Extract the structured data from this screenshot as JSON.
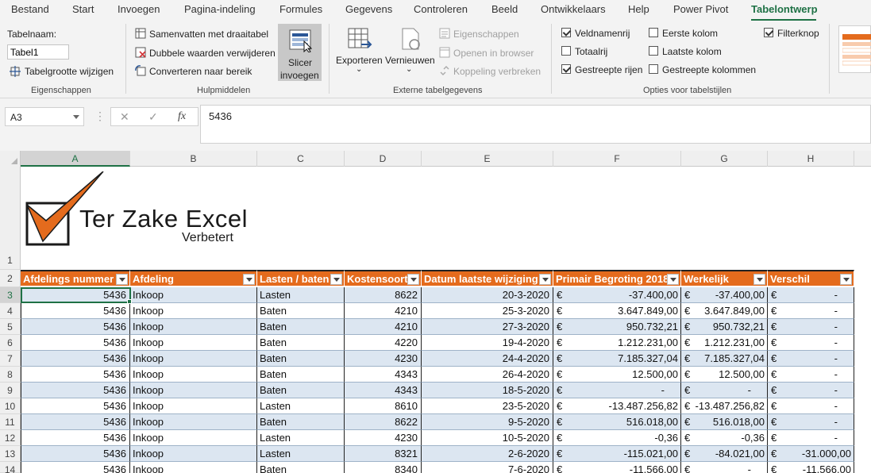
{
  "menu": {
    "items": [
      "Bestand",
      "Start",
      "Invoegen",
      "Pagina-indeling",
      "Formules",
      "Gegevens",
      "Controleren",
      "Beeld",
      "Ontwikkelaars",
      "Help",
      "Power Pivot",
      "Tabelontwerp"
    ],
    "active": "Tabelontwerp"
  },
  "ribbon": {
    "eigenschappen": {
      "tablename_label": "Tabelnaam:",
      "tablename_value": "Tabel1",
      "resize_label": "Tabelgrootte wijzigen",
      "group_label": "Eigenschappen"
    },
    "hulpmiddelen": {
      "pivot_label": "Samenvatten met draaitabel",
      "dedupe_label": "Dubbele waarden verwijderen",
      "convert_label": "Converteren naar bereik",
      "slicer_line1": "Slicer",
      "slicer_line2": "invoegen",
      "group_label": "Hulpmiddelen"
    },
    "extern": {
      "export_label": "Exporteren",
      "refresh_label": "Vernieuwen",
      "properties_label": "Eigenschappen",
      "browser_label": "Openen in browser",
      "unlink_label": "Koppeling verbreken",
      "group_label": "Externe tabelgegevens"
    },
    "opties": {
      "header_row": {
        "label": "Veldnamenrij",
        "checked": true
      },
      "total_row": {
        "label": "Totaalrij",
        "checked": false
      },
      "banded_rows": {
        "label": "Gestreepte rijen",
        "checked": true
      },
      "first_column": {
        "label": "Eerste kolom",
        "checked": false
      },
      "last_column": {
        "label": "Laatste kolom",
        "checked": false
      },
      "banded_columns": {
        "label": "Gestreepte kolommen",
        "checked": false
      },
      "filter_button": {
        "label": "Filterknop",
        "checked": true
      },
      "group_label": "Opties voor tabelstijlen"
    }
  },
  "formula_bar": {
    "name_box": "A3",
    "cancel_glyph": "✕",
    "confirm_glyph": "✓",
    "fx_glyph": "fx",
    "formula": "5436"
  },
  "sheet": {
    "columns": [
      "A",
      "B",
      "C",
      "D",
      "E",
      "F",
      "G",
      "H"
    ],
    "selected_column": "A",
    "row_numbers": [
      "1",
      "2",
      "3",
      "4",
      "5",
      "6",
      "7",
      "8",
      "9",
      "10",
      "11",
      "12",
      "13",
      "14"
    ],
    "selected_row": "3",
    "logo_title": "Ter Zake Excel",
    "logo_subtitle": "Verbetert",
    "brand_color": "#e46b1d",
    "band_color": "#dce6f1",
    "currency_symbol": "€",
    "headers": [
      "Afdelings nummer",
      "Afdeling",
      "Lasten / baten",
      "Kostensoort",
      "Datum laatste wijziging",
      "Primair Begroting 2018",
      "Werkelijk",
      "Verschil"
    ],
    "rows": [
      [
        "5436",
        "Inkoop",
        "Lasten",
        "8622",
        "20-3-2020",
        "-37.400,00",
        "-37.400,00",
        "-"
      ],
      [
        "5436",
        "Inkoop",
        "Baten",
        "4210",
        "25-3-2020",
        "3.647.849,00",
        "3.647.849,00",
        "-"
      ],
      [
        "5436",
        "Inkoop",
        "Baten",
        "4210",
        "27-3-2020",
        "950.732,21",
        "950.732,21",
        "-"
      ],
      [
        "5436",
        "Inkoop",
        "Baten",
        "4220",
        "19-4-2020",
        "1.212.231,00",
        "1.212.231,00",
        "-"
      ],
      [
        "5436",
        "Inkoop",
        "Baten",
        "4230",
        "24-4-2020",
        "7.185.327,04",
        "7.185.327,04",
        "-"
      ],
      [
        "5436",
        "Inkoop",
        "Baten",
        "4343",
        "26-4-2020",
        "12.500,00",
        "12.500,00",
        "-"
      ],
      [
        "5436",
        "Inkoop",
        "Baten",
        "4343",
        "18-5-2020",
        "-",
        "-",
        "-"
      ],
      [
        "5436",
        "Inkoop",
        "Lasten",
        "8610",
        "23-5-2020",
        "-13.487.256,82",
        "-13.487.256,82",
        "-"
      ],
      [
        "5436",
        "Inkoop",
        "Baten",
        "8622",
        "9-5-2020",
        "516.018,00",
        "516.018,00",
        "-"
      ],
      [
        "5436",
        "Inkoop",
        "Lasten",
        "4230",
        "10-5-2020",
        "-0,36",
        "-0,36",
        "-"
      ],
      [
        "5436",
        "Inkoop",
        "Lasten",
        "8321",
        "2-6-2020",
        "-115.021,00",
        "-84.021,00",
        "-31.000,00"
      ],
      [
        "5436",
        "Inkoop",
        "Baten",
        "8340",
        "7-6-2020",
        "-11.566,00",
        "-",
        "-11.566,00"
      ]
    ]
  }
}
